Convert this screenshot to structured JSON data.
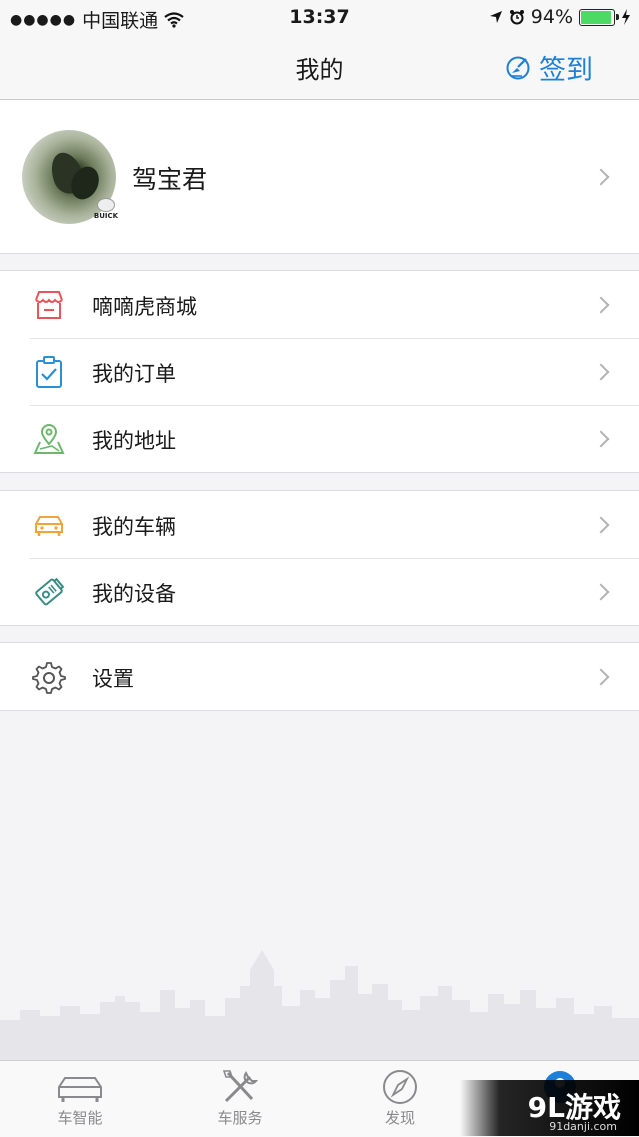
{
  "status_bar": {
    "signal": "●●●●●",
    "carrier": "中国联通",
    "time": "13:37",
    "battery": "94%",
    "battery_level": 0.94
  },
  "nav": {
    "title": "我的",
    "signin_label": "签到"
  },
  "profile": {
    "name": "驾宝君",
    "badge_text": "BUICK"
  },
  "menu_groups": [
    [
      {
        "label": "嘀嘀虎商城",
        "icon": "store-icon",
        "color": "#e8545a"
      },
      {
        "label": "我的订单",
        "icon": "clipboard-check-icon",
        "color": "#2b8fd6"
      },
      {
        "label": "我的地址",
        "icon": "map-pin-icon",
        "color": "#6cb86a"
      }
    ],
    [
      {
        "label": "我的车辆",
        "icon": "car-icon",
        "color": "#f0a43a"
      },
      {
        "label": "我的设备",
        "icon": "device-tag-icon",
        "color": "#3a8a84"
      }
    ],
    [
      {
        "label": "设置",
        "icon": "gear-icon",
        "color": "#555555"
      }
    ]
  ],
  "tabs": [
    {
      "label": "车智能",
      "icon": "car-outline-icon"
    },
    {
      "label": "车服务",
      "icon": "tools-icon"
    },
    {
      "label": "发现",
      "icon": "compass-icon"
    },
    {
      "label": "",
      "icon": "profile-icon"
    }
  ],
  "watermark": {
    "brand": "9L游戏",
    "url": "91danji.com"
  },
  "colors": {
    "accent": "#1c7fd8",
    "background": "#f4f4f6"
  }
}
